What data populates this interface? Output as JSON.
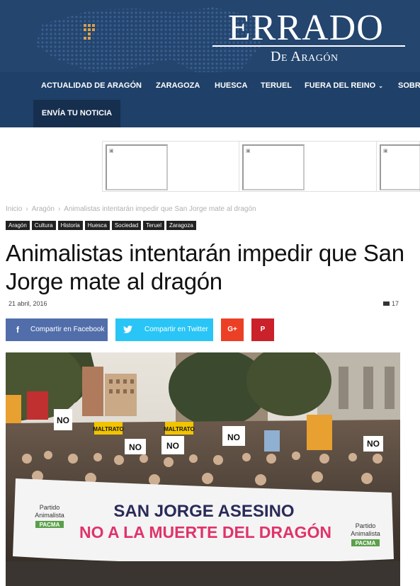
{
  "header": {
    "logo_main": "ERRADO",
    "logo_sub": "De Aragón"
  },
  "nav": {
    "items": [
      {
        "label": "ACTUALIDAD DE ARAGÓN"
      },
      {
        "label": "ZARAGOZA"
      },
      {
        "label": "HUESCA"
      },
      {
        "label": "TERUEL"
      },
      {
        "label": "FUERA DEL REINO",
        "caret": "⌄"
      },
      {
        "label": "SOBRE"
      }
    ],
    "send_news": "ENVÍA TU NOTICIA"
  },
  "breadcrumb": [
    "Inicio",
    "Aragón",
    "Animalistas intentarán impedir que San Jorge mate al dragón"
  ],
  "breadcrumb_sep": "›",
  "tags": [
    "Aragón",
    "Cultura",
    "Historia",
    "Huesca",
    "Sociedad",
    "Teruel",
    "Zaragoza"
  ],
  "article": {
    "title": "Animalistas intentarán impedir que San Jorge mate al dragón",
    "date": "21 abril, 2016",
    "comments": "17"
  },
  "share": {
    "facebook": "Compartir en Facebook",
    "twitter": "Compartir en Twitter",
    "facebook_icon": "f",
    "twitter_icon": "🐦",
    "googleplus_icon": "G+",
    "pinterest_icon": "P"
  },
  "photo": {
    "banner_line1": "SAN JORGE ASESINO",
    "banner_line2": "NO A LA MUERTE DEL DRAGÓN",
    "banner_logo_left": "Partido\nAnimalista",
    "banner_logo_right": "Partido\nAnimalista",
    "pacma": "PACMA",
    "signs": [
      "NO",
      "NO",
      "NO",
      "NO",
      "MALTRATO",
      "MALTRATO",
      "NO"
    ]
  },
  "colors": {
    "header_bg": "#23456e",
    "nav_bg": "#1f4068",
    "facebook": "#516eab",
    "twitter": "#29c5f6",
    "googleplus": "#eb4026",
    "pinterest": "#ca212a"
  }
}
